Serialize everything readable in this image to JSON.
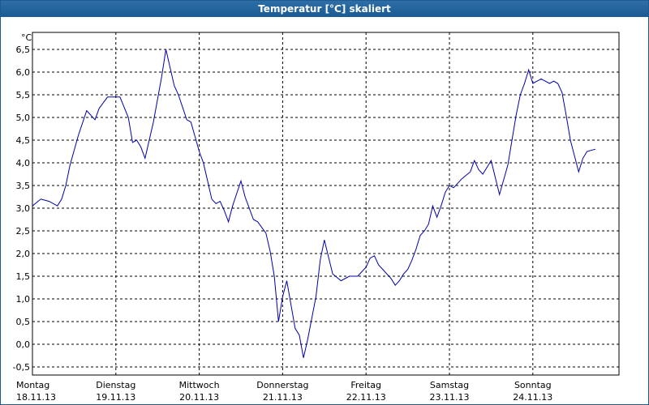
{
  "window": {
    "title": "Temperatur [°C] skaliert"
  },
  "chart_data": {
    "type": "line",
    "title": "Temperatur [°C] skaliert",
    "unit": "°C",
    "xlabel": "",
    "ylabel": "",
    "ylim": [
      -0.5,
      6.5
    ],
    "y_ticks": [
      {
        "value": -0.5,
        "label": "-0,5"
      },
      {
        "value": 0.0,
        "label": "0,0"
      },
      {
        "value": 0.5,
        "label": "0,5"
      },
      {
        "value": 1.0,
        "label": "1,0"
      },
      {
        "value": 1.5,
        "label": "1,5"
      },
      {
        "value": 2.0,
        "label": "2,0"
      },
      {
        "value": 2.5,
        "label": "2,5"
      },
      {
        "value": 3.0,
        "label": "3,0"
      },
      {
        "value": 3.5,
        "label": "3,5"
      },
      {
        "value": 4.0,
        "label": "4,0"
      },
      {
        "value": 4.5,
        "label": "4,5"
      },
      {
        "value": 5.0,
        "label": "5,0"
      },
      {
        "value": 5.5,
        "label": "5,5"
      },
      {
        "value": 6.0,
        "label": "6,0"
      },
      {
        "value": 6.5,
        "label": "6,5"
      }
    ],
    "x_ticks": [
      {
        "day": "Montag",
        "date": "18.11.13"
      },
      {
        "day": "Dienstag",
        "date": "19.11.13"
      },
      {
        "day": "Mittwoch",
        "date": "20.11.13"
      },
      {
        "day": "Donnerstag",
        "date": "21.11.13"
      },
      {
        "day": "Freitag",
        "date": "22.11.13"
      },
      {
        "day": "Samstag",
        "date": "23.11.13"
      },
      {
        "day": "Sonntag",
        "date": "24.11.13"
      }
    ],
    "grid": true,
    "line_color": "#0000aa",
    "grid_color": "#000000",
    "series": [
      {
        "x": [
          0,
          0.1,
          0.2,
          0.3,
          0.35,
          0.4,
          0.45,
          0.55,
          0.65,
          0.75,
          0.8,
          0.9,
          0.95,
          1.05,
          1.15,
          1.2,
          1.25,
          1.3,
          1.35,
          1.45,
          1.55,
          1.6,
          1.7,
          1.75,
          1.85,
          1.9,
          2.0,
          2.05,
          2.1,
          2.15,
          2.2,
          2.25,
          2.3,
          2.35,
          2.4,
          2.5,
          2.55,
          2.65,
          2.7,
          2.8,
          2.85,
          2.9,
          2.95,
          3.0,
          3.05,
          3.15,
          3.2,
          3.25,
          3.3,
          3.4,
          3.45,
          3.5,
          3.6,
          3.7,
          3.8,
          3.9,
          4.0,
          4.05,
          4.1,
          4.15,
          4.2,
          4.3,
          4.35,
          4.4,
          4.45,
          4.5,
          4.55,
          4.6,
          4.65,
          4.7,
          4.75,
          4.8,
          4.85,
          4.9,
          4.95,
          5.0,
          5.05,
          5.1,
          5.15,
          5.25,
          5.3,
          5.35,
          5.4,
          5.45,
          5.5,
          5.6,
          5.7,
          5.8,
          5.85,
          5.9,
          5.95,
          6.0,
          6.05,
          6.1,
          6.15,
          6.2,
          6.25,
          6.3,
          6.35,
          6.4,
          6.45,
          6.55,
          6.6,
          6.65,
          6.75
        ],
        "values": [
          3.05,
          3.2,
          3.15,
          3.05,
          3.2,
          3.5,
          3.95,
          4.6,
          5.15,
          4.95,
          5.2,
          5.45,
          5.45,
          5.45,
          5.0,
          4.45,
          4.5,
          4.35,
          4.1,
          4.9,
          5.9,
          6.5,
          5.7,
          5.5,
          4.95,
          4.9,
          4.25,
          4.0,
          3.6,
          3.2,
          3.1,
          3.15,
          2.95,
          2.7,
          3.05,
          3.6,
          3.25,
          2.75,
          2.7,
          2.45,
          2.05,
          1.5,
          0.5,
          1.05,
          1.4,
          0.35,
          0.2,
          -0.3,
          0.1,
          1.05,
          1.85,
          2.3,
          1.55,
          1.4,
          1.5,
          1.5,
          1.7,
          1.9,
          1.95,
          1.75,
          1.65,
          1.45,
          1.3,
          1.4,
          1.55,
          1.65,
          1.85,
          2.1,
          2.4,
          2.5,
          2.65,
          3.05,
          2.8,
          3.05,
          3.35,
          3.5,
          3.45,
          3.55,
          3.65,
          3.8,
          4.05,
          3.85,
          3.75,
          3.9,
          4.05,
          3.3,
          3.95,
          5.05,
          5.5,
          5.75,
          6.05,
          5.75,
          5.8,
          5.85,
          5.8,
          5.75,
          5.8,
          5.75,
          5.55,
          5.05,
          4.5,
          3.8,
          4.1,
          4.25,
          4.3
        ]
      }
    ]
  }
}
